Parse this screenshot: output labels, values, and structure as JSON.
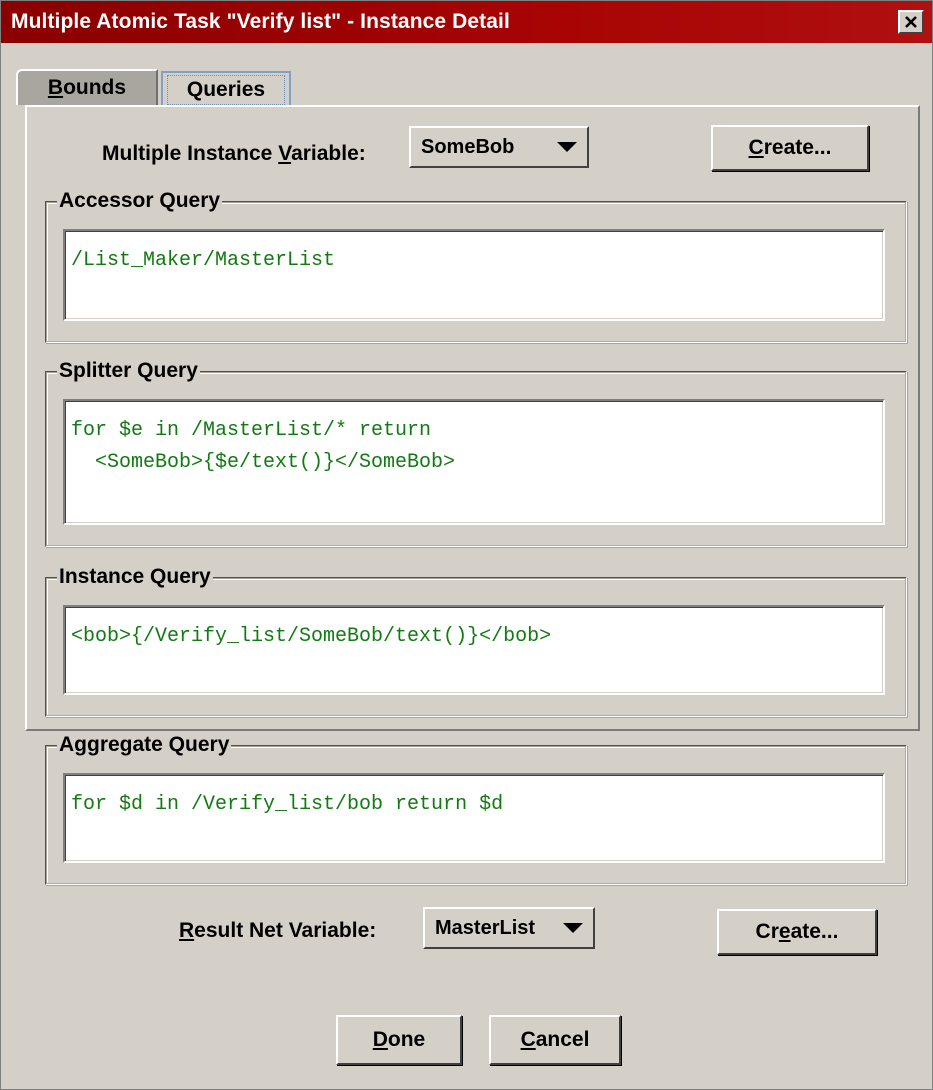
{
  "window": {
    "title": "Multiple Atomic Task \"Verify list\" - Instance Detail"
  },
  "tabs": [
    {
      "label_mnemonic": "B",
      "label_rest": "ounds"
    },
    {
      "label": "Queries"
    }
  ],
  "mi_variable": {
    "label_pre": "Multiple Instance ",
    "label_mnemonic": "V",
    "label_post": "ariable:",
    "value": "SomeBob"
  },
  "create_top": {
    "mnemonic": "C",
    "rest": "reate..."
  },
  "groups": {
    "accessor": {
      "title": "Accessor Query",
      "text": "/List_Maker/MasterList"
    },
    "splitter": {
      "title": "Splitter Query",
      "text": "for $e in /MasterList/* return\n  <SomeBob>{$e/text()}</SomeBob>"
    },
    "instance": {
      "title": "Instance Query",
      "text": "<bob>{/Verify_list/SomeBob/text()}</bob>"
    },
    "aggregate": {
      "title": "Aggregate Query",
      "text": "for $d in /Verify_list/bob return $d"
    }
  },
  "result_variable": {
    "label_mnemonic": "R",
    "label_rest": "esult Net Variable:",
    "value": "MasterList"
  },
  "create_bottom": {
    "pre": "Cr",
    "mnemonic": "e",
    "post": "ate..."
  },
  "done_button": {
    "mnemonic": "D",
    "rest": "one"
  },
  "cancel_button": {
    "mnemonic": "C",
    "rest": "ancel"
  }
}
